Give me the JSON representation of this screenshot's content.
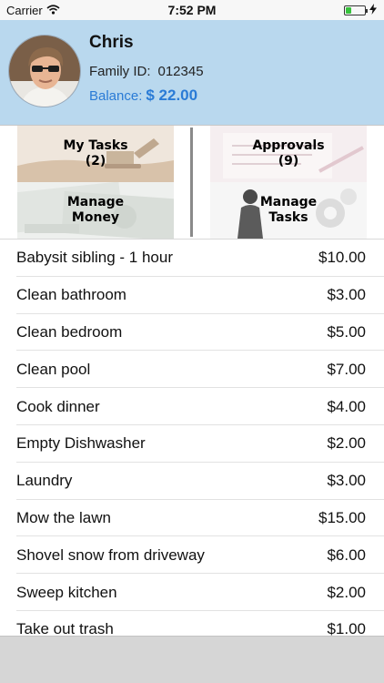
{
  "status_bar": {
    "carrier": "Carrier",
    "time": "7:52 PM",
    "battery_level": 0.3,
    "battery_color": "#36c23b"
  },
  "profile": {
    "name": "Chris",
    "family_id_label": "Family ID:",
    "family_id": "012345",
    "balance_label": "Balance:",
    "balance_value": "$ 22.00",
    "header_color": "#b9d8ee",
    "balance_color": "#2a7bd6"
  },
  "tiles": [
    {
      "line1": "My Tasks",
      "line2": "(2)",
      "icon": "excavator-image"
    },
    {
      "line1": "Approvals",
      "line2": "(9)",
      "icon": "signing-document-image"
    },
    {
      "line1": "Manage",
      "line2": "Money",
      "icon": "dollar-bills-image"
    },
    {
      "line1": "Manage",
      "line2": "Tasks",
      "icon": "businesswoman-gears-image"
    }
  ],
  "tasks": [
    {
      "name": "Babysit sibling - 1 hour",
      "amount": "$10.00"
    },
    {
      "name": "Clean bathroom",
      "amount": "$3.00"
    },
    {
      "name": "Clean bedroom",
      "amount": "$5.00"
    },
    {
      "name": "Clean pool",
      "amount": "$7.00"
    },
    {
      "name": "Cook dinner",
      "amount": "$4.00"
    },
    {
      "name": "Empty Dishwasher",
      "amount": "$2.00"
    },
    {
      "name": "Laundry",
      "amount": "$3.00"
    },
    {
      "name": "Mow the lawn",
      "amount": "$15.00"
    },
    {
      "name": "Shovel snow from driveway",
      "amount": "$6.00"
    },
    {
      "name": "Sweep kitchen",
      "amount": "$2.00"
    },
    {
      "name": "Take out trash",
      "amount": "$1.00"
    }
  ]
}
